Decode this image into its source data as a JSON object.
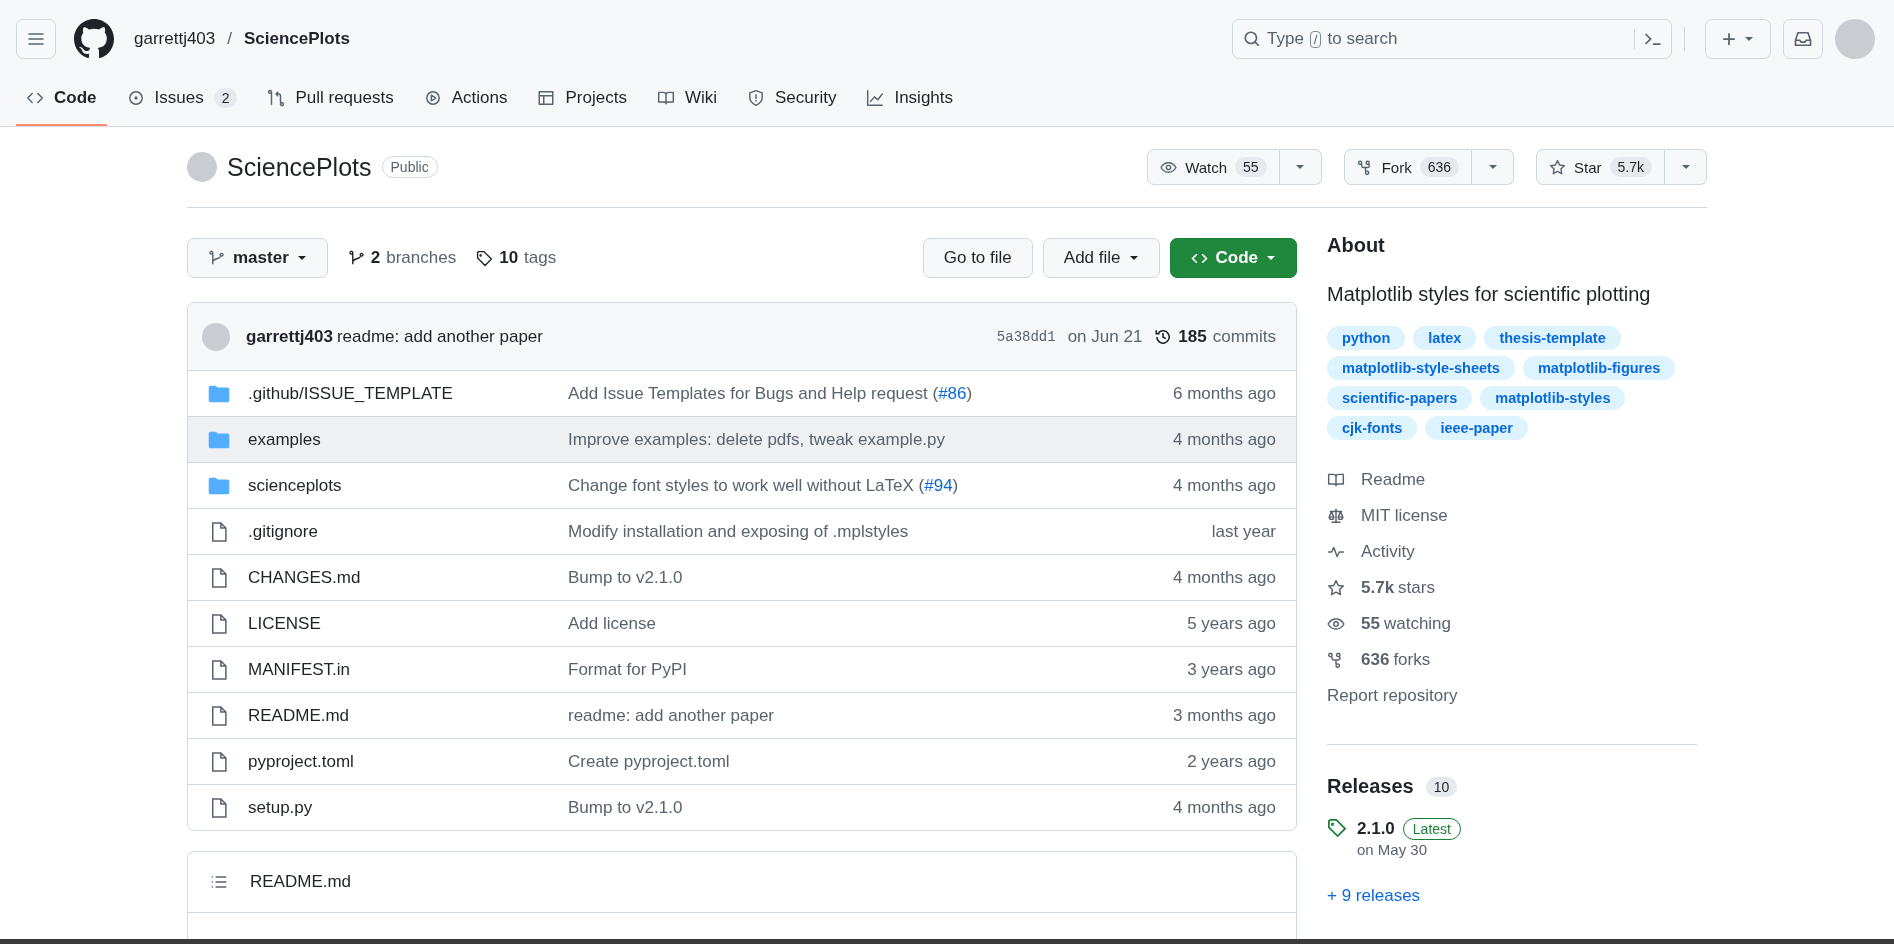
{
  "header": {
    "owner": "garrettj403",
    "separator": "/",
    "repo": "SciencePlots",
    "search_placeholder_before": "Type",
    "search_key": "/",
    "search_placeholder_after": "to search",
    "new_button": "+"
  },
  "tabs": [
    {
      "label": "Code",
      "selected": true
    },
    {
      "label": "Issues",
      "count": "2",
      "selected": false
    },
    {
      "label": "Pull requests",
      "selected": false
    },
    {
      "label": "Actions",
      "selected": false
    },
    {
      "label": "Projects",
      "selected": false
    },
    {
      "label": "Wiki",
      "selected": false
    },
    {
      "label": "Security",
      "selected": false
    },
    {
      "label": "Insights",
      "selected": false
    }
  ],
  "repo": {
    "name": "SciencePlots",
    "visibility": "Public",
    "actions": [
      {
        "label": "Watch",
        "count": "55"
      },
      {
        "label": "Fork",
        "count": "636"
      },
      {
        "label": "Star",
        "count": "5.7k"
      }
    ]
  },
  "toolbar": {
    "branch": "master",
    "branches_count": "2",
    "branches_label": "branches",
    "tags_count": "10",
    "tags_label": "tags",
    "go_to_file": "Go to file",
    "add_file": "Add file",
    "code": "Code"
  },
  "latest_commit": {
    "author": "garrettj403",
    "message": "readme: add another paper",
    "hash": "5a38dd1",
    "date": "on Jun 21",
    "commits_count": "185",
    "commits_label": "commits"
  },
  "files": [
    {
      "kind": "folder",
      "name": ".github/ISSUE_TEMPLATE",
      "message": "Add Issue Templates for Bugs and Help request (",
      "link": "#86",
      "message_end": ")",
      "age": "6 months ago",
      "highlighted": false
    },
    {
      "kind": "folder",
      "name": "examples",
      "message": "Improve examples: delete pdfs, tweak example.py",
      "age": "4 months ago",
      "highlighted": true
    },
    {
      "kind": "folder",
      "name": "scienceplots",
      "message": "Change font styles to work well without LaTeX (",
      "link": "#94",
      "message_end": ")",
      "age": "4 months ago",
      "highlighted": false
    },
    {
      "kind": "file",
      "name": ".gitignore",
      "message": "Modify installation and exposing of .mplstyles",
      "age": "last year",
      "highlighted": false
    },
    {
      "kind": "file",
      "name": "CHANGES.md",
      "message": "Bump to v2.1.0",
      "age": "4 months ago",
      "highlighted": false
    },
    {
      "kind": "file",
      "name": "LICENSE",
      "message": "Add license",
      "age": "5 years ago",
      "highlighted": false
    },
    {
      "kind": "file",
      "name": "MANIFEST.in",
      "message": "Format for PyPI",
      "age": "3 years ago",
      "highlighted": false
    },
    {
      "kind": "file",
      "name": "README.md",
      "message": "readme: add another paper",
      "age": "3 months ago",
      "highlighted": false
    },
    {
      "kind": "file",
      "name": "pyproject.toml",
      "message": "Create pyproject.toml",
      "age": "2 years ago",
      "highlighted": false
    },
    {
      "kind": "file",
      "name": "setup.py",
      "message": "Bump to v2.1.0",
      "age": "4 months ago",
      "highlighted": false
    }
  ],
  "readme": {
    "title": "README.md"
  },
  "about": {
    "title": "About",
    "description": "Matplotlib styles for scientific plotting",
    "topics": [
      "python",
      "latex",
      "thesis-template",
      "matplotlib-style-sheets",
      "matplotlib-figures",
      "scientific-papers",
      "matplotlib-styles",
      "cjk-fonts",
      "ieee-paper"
    ],
    "links": [
      {
        "label": "Readme"
      },
      {
        "label": "MIT license"
      },
      {
        "label": "Activity"
      },
      {
        "count": "5.7k",
        "label": "stars"
      },
      {
        "count": "55",
        "label": "watching"
      },
      {
        "count": "636",
        "label": "forks"
      }
    ],
    "report": "Report repository"
  },
  "releases": {
    "title": "Releases",
    "count": "10",
    "latest_version": "2.1.0",
    "latest_badge": "Latest",
    "latest_date": "on May 30",
    "more": "+ 9 releases"
  }
}
